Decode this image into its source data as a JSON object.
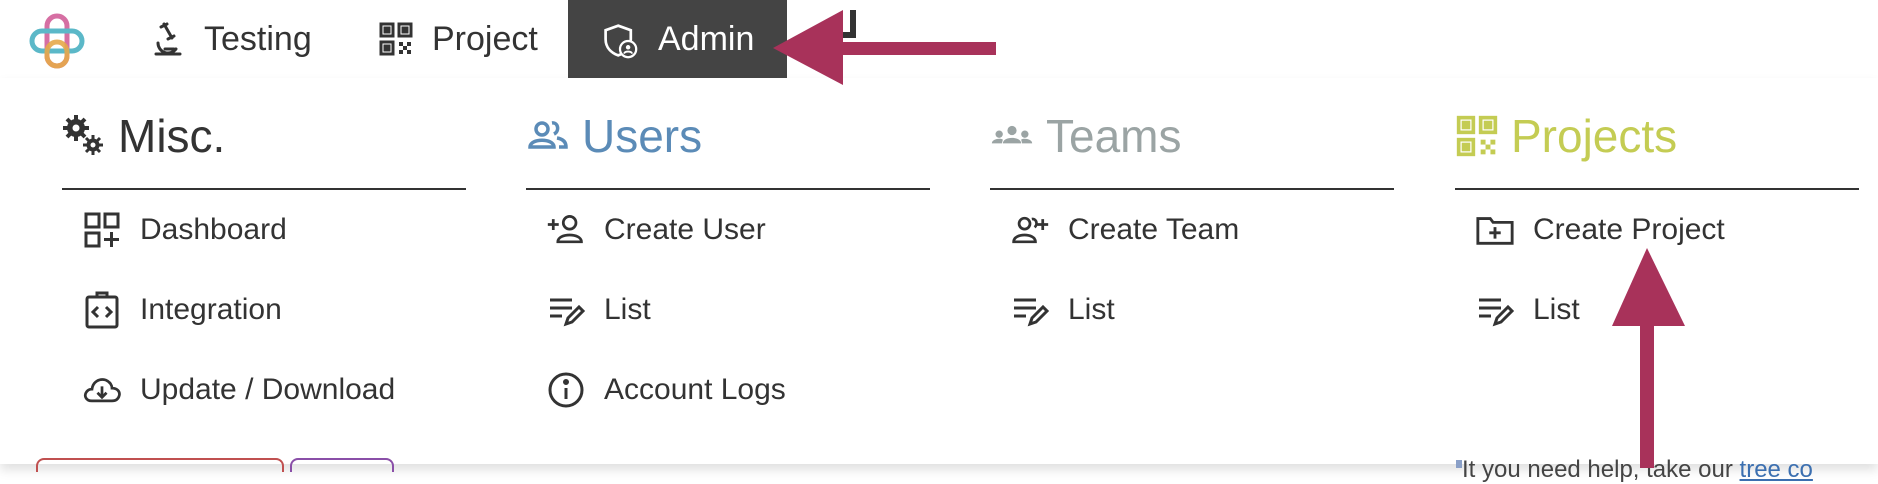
{
  "nav": {
    "items": [
      {
        "label": "Testing",
        "icon": "microscope-icon"
      },
      {
        "label": "Project",
        "icon": "qr-grid-icon"
      },
      {
        "label": "Admin",
        "icon": "shield-user-icon",
        "active": true
      }
    ],
    "active_bg": "#444444"
  },
  "menu": {
    "columns": [
      {
        "title": "Misc.",
        "icon": "gears-icon",
        "color": "#333333",
        "items": [
          {
            "label": "Dashboard",
            "icon": "dashboard-add-icon"
          },
          {
            "label": "Integration",
            "icon": "code-clipboard-icon"
          },
          {
            "label": "Update / Download",
            "icon": "cloud-download-icon"
          }
        ]
      },
      {
        "title": "Users",
        "icon": "users-icon",
        "color": "#5b8bb7",
        "items": [
          {
            "label": "Create User",
            "icon": "add-user-icon"
          },
          {
            "label": "List",
            "icon": "list-edit-icon"
          },
          {
            "label": "Account Logs",
            "icon": "info-circle-icon"
          }
        ]
      },
      {
        "title": "Teams",
        "icon": "team-icon",
        "color": "#9ba4a4",
        "items": [
          {
            "label": "Create Team",
            "icon": "add-team-icon"
          },
          {
            "label": "List",
            "icon": "list-edit-icon"
          }
        ]
      },
      {
        "title": "Projects",
        "icon": "qr-grid-icon",
        "color": "#c4cc53",
        "items": [
          {
            "label": "Create Project",
            "icon": "folder-add-icon"
          },
          {
            "label": "List",
            "icon": "list-edit-icon"
          }
        ]
      }
    ]
  },
  "background_page": {
    "partial_text": "It you need help, take our",
    "partial_link": "tree co"
  },
  "annotation": {
    "arrow_color": "#a8325a"
  }
}
